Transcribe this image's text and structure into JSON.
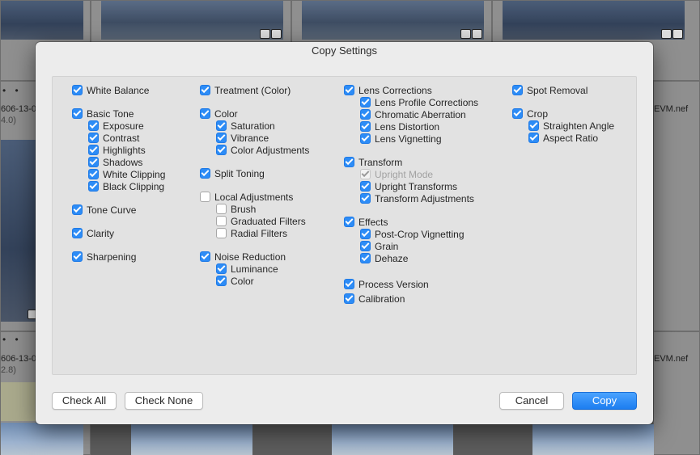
{
  "dialog": {
    "title": "Copy Settings"
  },
  "background": {
    "filename_suffix_1": "EVM.nef",
    "filename_suffix_2": "EVM.nef",
    "left_name_1": "606-13-0",
    "left_meta_1": "4.0)",
    "left_name_2": "606-13-0",
    "left_meta_2": "2.8)",
    "dots": "• •"
  },
  "columns": [
    [
      {
        "label": "White Balance",
        "state": "on",
        "indent": 0
      },
      {
        "label": "Basic Tone",
        "state": "on",
        "indent": 0
      },
      {
        "label": "Exposure",
        "state": "on",
        "indent": 1
      },
      {
        "label": "Contrast",
        "state": "on",
        "indent": 1
      },
      {
        "label": "Highlights",
        "state": "on",
        "indent": 1
      },
      {
        "label": "Shadows",
        "state": "on",
        "indent": 1
      },
      {
        "label": "White Clipping",
        "state": "on",
        "indent": 1
      },
      {
        "label": "Black Clipping",
        "state": "on",
        "indent": 1
      },
      {
        "label": "Tone Curve",
        "state": "on",
        "indent": 0
      },
      {
        "label": "Clarity",
        "state": "on",
        "indent": 0
      },
      {
        "label": "Sharpening",
        "state": "on",
        "indent": 0
      }
    ],
    [
      {
        "label": "Treatment (Color)",
        "state": "on",
        "indent": 0
      },
      {
        "label": "Color",
        "state": "on",
        "indent": 0
      },
      {
        "label": "Saturation",
        "state": "on",
        "indent": 1
      },
      {
        "label": "Vibrance",
        "state": "on",
        "indent": 1
      },
      {
        "label": "Color Adjustments",
        "state": "on",
        "indent": 1
      },
      {
        "label": "Split Toning",
        "state": "on",
        "indent": 0
      },
      {
        "label": "Local Adjustments",
        "state": "off",
        "indent": 0
      },
      {
        "label": "Brush",
        "state": "off",
        "indent": 1
      },
      {
        "label": "Graduated Filters",
        "state": "off",
        "indent": 1
      },
      {
        "label": "Radial Filters",
        "state": "off",
        "indent": 1
      },
      {
        "label": "Noise Reduction",
        "state": "on",
        "indent": 0
      },
      {
        "label": "Luminance",
        "state": "on",
        "indent": 1
      },
      {
        "label": "Color",
        "state": "on",
        "indent": 1
      }
    ],
    [
      {
        "label": "Lens Corrections",
        "state": "on",
        "indent": 0
      },
      {
        "label": "Lens Profile Corrections",
        "state": "on",
        "indent": 1
      },
      {
        "label": "Chromatic Aberration",
        "state": "on",
        "indent": 1
      },
      {
        "label": "Lens Distortion",
        "state": "on",
        "indent": 1
      },
      {
        "label": "Lens Vignetting",
        "state": "on",
        "indent": 1
      },
      {
        "label": "Transform",
        "state": "on",
        "indent": 0
      },
      {
        "label": "Upright Mode",
        "state": "disabled",
        "indent": 1
      },
      {
        "label": "Upright Transforms",
        "state": "on",
        "indent": 1
      },
      {
        "label": "Transform Adjustments",
        "state": "on",
        "indent": 1
      },
      {
        "label": "Effects",
        "state": "on",
        "indent": 0
      },
      {
        "label": "Post-Crop Vignetting",
        "state": "on",
        "indent": 1
      },
      {
        "label": "Grain",
        "state": "on",
        "indent": 1
      },
      {
        "label": "Dehaze",
        "state": "on",
        "indent": 1
      },
      {
        "label": "Process Version",
        "state": "on",
        "indent": 0
      },
      {
        "label": "Calibration",
        "state": "on",
        "indent": 0
      }
    ],
    [
      {
        "label": "Spot Removal",
        "state": "on",
        "indent": 0
      },
      {
        "label": "Crop",
        "state": "on",
        "indent": 0
      },
      {
        "label": "Straighten Angle",
        "state": "on",
        "indent": 1
      },
      {
        "label": "Aspect Ratio",
        "state": "on",
        "indent": 1
      }
    ]
  ],
  "buttons": {
    "check_all": "Check All",
    "check_none": "Check None",
    "cancel": "Cancel",
    "copy": "Copy"
  },
  "colors": {
    "accent": "#2d8cf6",
    "dialog_bg": "#ececec"
  }
}
